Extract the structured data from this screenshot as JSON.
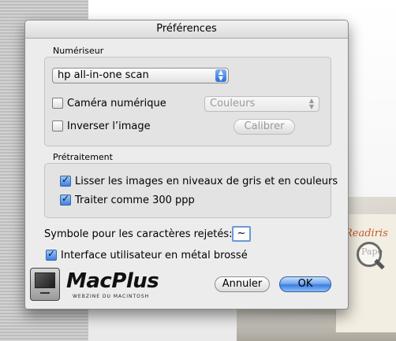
{
  "window": {
    "title": "Préférences"
  },
  "scanner_group": {
    "label": "Numériseur",
    "device_popup": {
      "value": "hp all-in-one scan"
    },
    "digital_camera": {
      "label": "Caméra numérique",
      "checked": false
    },
    "color_popup": {
      "value": "Couleurs",
      "enabled": false
    },
    "invert_image": {
      "label": "Inverser l’image",
      "checked": false
    },
    "calibrate_button": {
      "label": "Calibrer",
      "enabled": false
    }
  },
  "preprocess_group": {
    "label": "Prétraitement",
    "smooth_images": {
      "label": "Lisser les images en niveaux de gris et en couleurs",
      "checked": true
    },
    "treat_300": {
      "label": "Traiter comme 300 ppp",
      "checked": true
    }
  },
  "rejected_symbol": {
    "label": "Symbole pour les caractères rejetés:",
    "value": "~"
  },
  "brushed_metal": {
    "label": "Interface utilisateur en métal brossé",
    "checked": true
  },
  "buttons": {
    "cancel": "Annuler",
    "ok": "OK"
  },
  "logo": {
    "name": "MacPlus",
    "tagline": "WEBZINE DU MACINTOSH"
  },
  "background": {
    "magazine_brand": "Readiris",
    "magazine_text": "Pape"
  },
  "colors": {
    "accent": "#3b7ee0",
    "window_bg": "#ececec",
    "group_bg": "#e3e3e3"
  }
}
